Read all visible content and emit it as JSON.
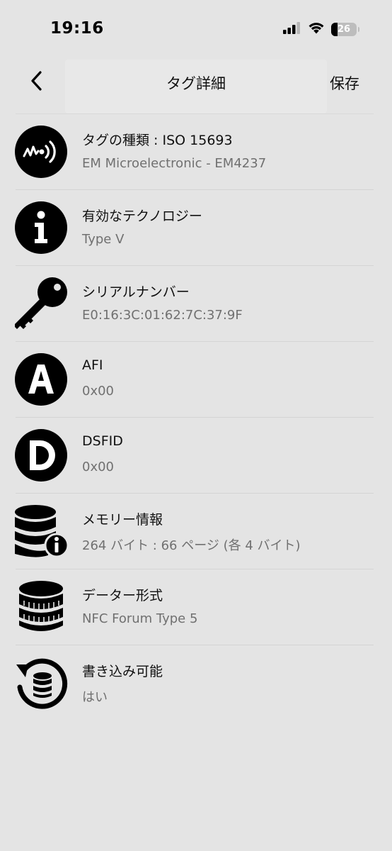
{
  "status_bar": {
    "time": "19:16",
    "battery_level": "26",
    "battery_fraction": 0.26,
    "icons": [
      "cellular-signal-icon",
      "wifi-icon",
      "battery-icon"
    ]
  },
  "nav": {
    "back_icon": "chevron-left-icon",
    "title": "タグ詳細",
    "save_label": "保存"
  },
  "items": [
    {
      "icon": "nfc-tag-icon",
      "label": "タグの種類 : ISO 15693",
      "value": "EM Microelectronic - EM4237"
    },
    {
      "icon": "info-icon",
      "label": "有効なテクノロジー",
      "value": "Type V"
    },
    {
      "icon": "key-icon",
      "label": "シリアルナンバー",
      "value": "E0:16:3C:01:62:7C:37:9F"
    },
    {
      "icon": "letter-a-icon",
      "label": "AFI",
      "value": "0x00"
    },
    {
      "icon": "letter-d-icon",
      "label": "DSFID",
      "value": "0x00"
    },
    {
      "icon": "database-info-icon",
      "label": "メモリー情報",
      "value": "264 バイト : 66 ページ (各 4 バイト)"
    },
    {
      "icon": "database-icon",
      "label": "データー形式",
      "value": "NFC Forum Type 5"
    },
    {
      "icon": "rewrite-database-icon",
      "label": "書き込み可能",
      "value": "はい"
    }
  ]
}
